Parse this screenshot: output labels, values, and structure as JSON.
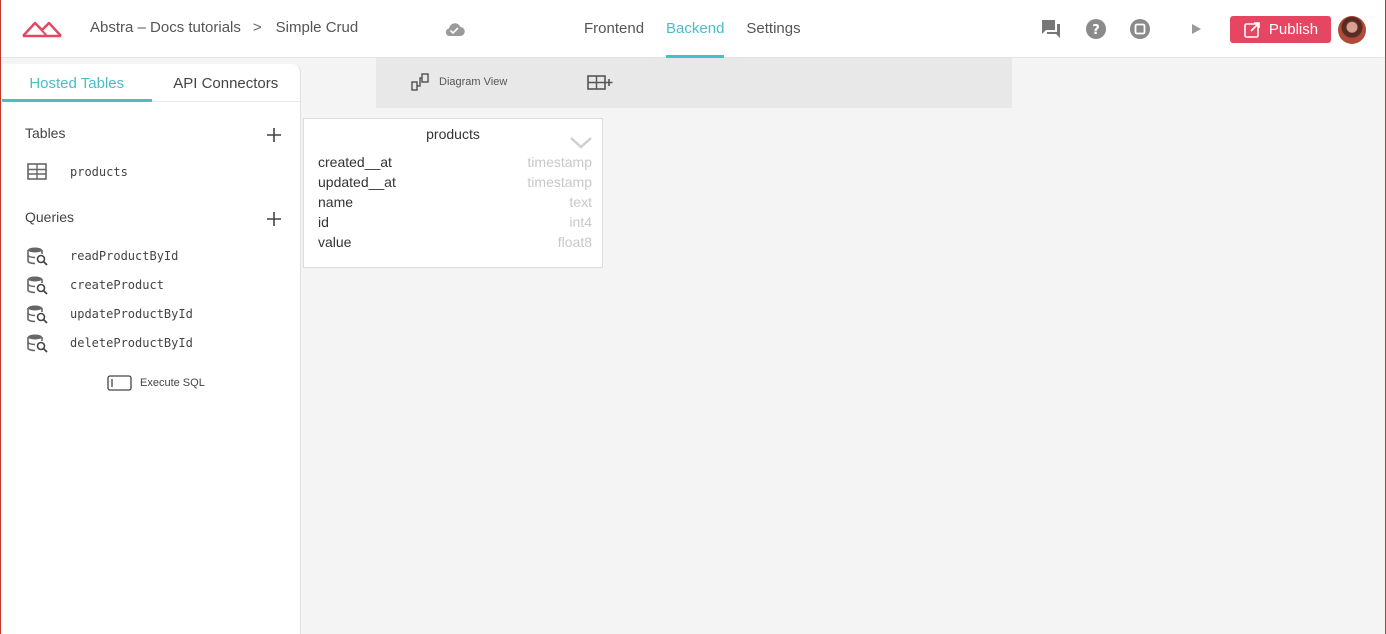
{
  "header": {
    "project_name": "Abstra – Docs tutorials",
    "breadcrumb_sep": ">",
    "page_name": "Simple Crud",
    "nav_tabs": [
      {
        "label": "Frontend",
        "active": false
      },
      {
        "label": "Backend",
        "active": true
      },
      {
        "label": "Settings",
        "active": false
      }
    ],
    "publish_label": "Publish",
    "accent_color": "#4bbdc5",
    "publish_color": "#e64661"
  },
  "sidebar": {
    "tabs": [
      {
        "label": "Hosted Tables",
        "active": true
      },
      {
        "label": "API Connectors",
        "active": false
      }
    ],
    "tables_title": "Tables",
    "tables": [
      {
        "label": "products",
        "icon": "table-icon"
      }
    ],
    "queries_title": "Queries",
    "queries": [
      {
        "label": "readProductById",
        "icon": "database-search-icon"
      },
      {
        "label": "createProduct",
        "icon": "database-search-icon"
      },
      {
        "label": "updateProductById",
        "icon": "database-search-icon"
      },
      {
        "label": "deleteProductById",
        "icon": "database-search-icon"
      }
    ],
    "execute_sql_label": "Execute SQL"
  },
  "toolbar": {
    "diagram_view_label": "Diagram View"
  },
  "table_card": {
    "name": "products",
    "fields": [
      {
        "name": "created__at",
        "type": "timestamp"
      },
      {
        "name": "updated__at",
        "type": "timestamp"
      },
      {
        "name": "name",
        "type": "text"
      },
      {
        "name": "id",
        "type": "int4"
      },
      {
        "name": "value",
        "type": "float8"
      }
    ]
  }
}
